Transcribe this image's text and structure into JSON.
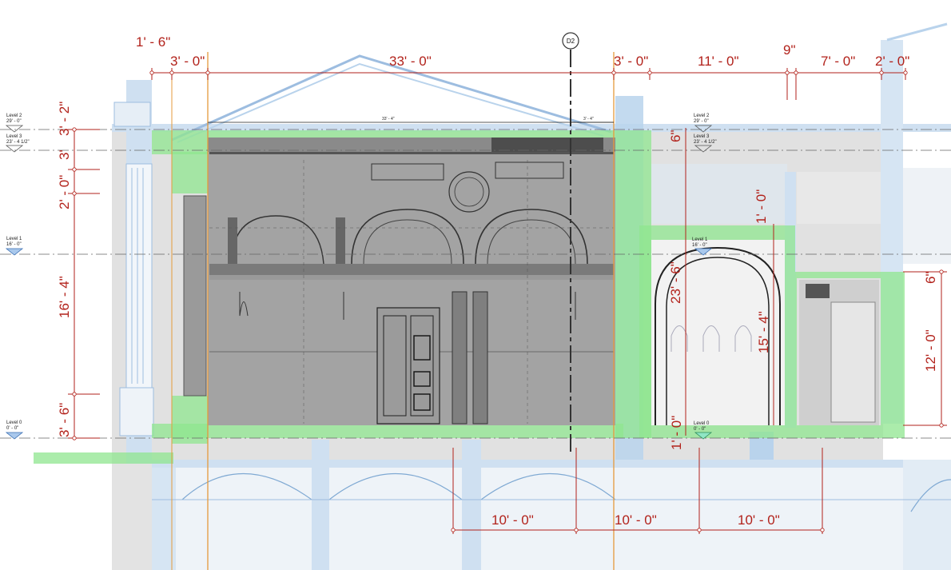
{
  "drawing": {
    "grid_bubble": "D2",
    "horizontal_dims_top": [
      "1' - 6\"",
      "3' - 0\"",
      "33' - 0\"",
      "3' - 0\"",
      "11' - 0\"",
      "9\"",
      "7' - 0\"",
      "2' - 0\""
    ],
    "small_dims": [
      "33' - 4\"",
      "3' - 4\""
    ],
    "vertical_dims_left": [
      "3' - 2\"",
      "3'",
      "2' - 0\"",
      "16' - 4\"",
      "3' - 6\""
    ],
    "vertical_dims_right": [
      "6\"",
      "1' - 0\"",
      "23' - 6\"",
      "15' - 4\"",
      "1' - 0\"",
      "6\"",
      "12' - 0\""
    ],
    "bottom_dims": [
      "10' - 0\"",
      "10' - 0\"",
      "10' - 0\""
    ],
    "levels_left": [
      {
        "name": "Level 2",
        "elev": "29' - 0\""
      },
      {
        "name": "Level 3",
        "elev": "23' - 4 1/2\""
      },
      {
        "name": "Level 1",
        "elev": "16' - 0\""
      },
      {
        "name": "Level 0",
        "elev": "0' - 0\""
      }
    ],
    "levels_right": [
      {
        "name": "Level 2",
        "elev": "29' - 0\""
      },
      {
        "name": "Level 3",
        "elev": "23' - 4 1/2\""
      },
      {
        "name": "Level 1",
        "elev": "16' - 0\""
      },
      {
        "name": "Level 0",
        "elev": "0' - 0\""
      }
    ],
    "colors": {
      "dimension": "#b2221b",
      "green_fill": "#8fe68f",
      "blue_structure": "#b9d3ec",
      "gray_drawing": "#a8a8a8",
      "orange_ref": "#e59a3c"
    }
  }
}
